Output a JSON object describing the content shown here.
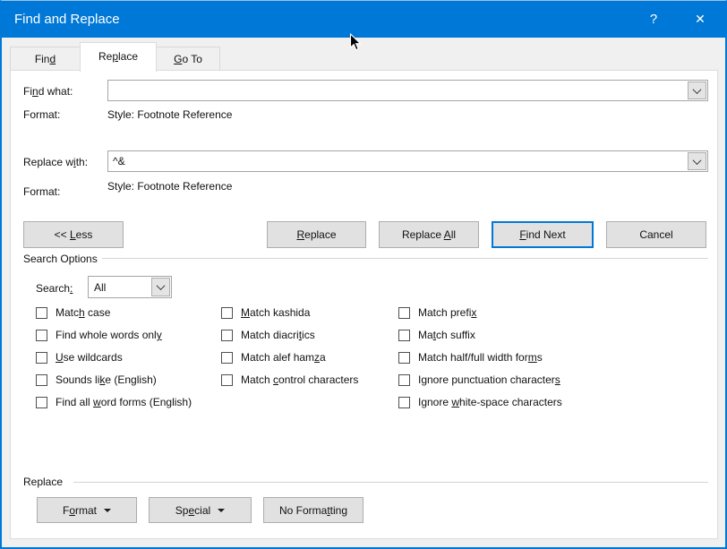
{
  "window": {
    "title": "Find and Replace",
    "help": "?",
    "close": "✕"
  },
  "colors": {
    "titlebar": "#0078d7",
    "accent": "#0078d7",
    "dialog_bg": "#f0f0f0",
    "page_bg": "#ffffff",
    "button_face": "#e1e1e1",
    "button_border": "#adadad"
  },
  "icons": {
    "help": "question-mark",
    "close": "x-cross",
    "combo_arrow": "chevron-down",
    "menu_arrow": "triangle-down"
  },
  "tabs": [
    {
      "pre": "Fin",
      "key": "d",
      "post": ""
    },
    {
      "pre": "Re",
      "key": "p",
      "post": "lace"
    },
    {
      "pre": "",
      "key": "G",
      "post": "o To"
    }
  ],
  "find_row": {
    "label": {
      "pre": "Fi",
      "key": "n",
      "post": "d what:"
    },
    "value": "",
    "format_label": "Format:",
    "format_value": "Style: Footnote Reference"
  },
  "replace_row": {
    "label": {
      "pre": "Replace w",
      "key": "i",
      "post": "th:"
    },
    "value": "^&",
    "format_label": "Format:",
    "format_value": "Style: Footnote Reference"
  },
  "action_buttons": {
    "less": {
      "pre": "<< ",
      "key": "L",
      "post": "ess"
    },
    "replace": {
      "pre": "",
      "key": "R",
      "post": "eplace"
    },
    "replace_all": {
      "pre": "Replace ",
      "key": "A",
      "post": "ll"
    },
    "find_next": {
      "pre": "",
      "key": "F",
      "post": "ind Next"
    },
    "cancel": {
      "pre": "Cancel",
      "key": "",
      "post": ""
    }
  },
  "search_options": {
    "group_label": "Search Options",
    "search_label": {
      "pre": "Search",
      "key": ":",
      "post": ""
    },
    "search_value": "All",
    "columns": [
      [
        {
          "pre": "Matc",
          "key": "h",
          "post": " case"
        },
        {
          "pre": "Find whole words onl",
          "key": "y",
          "post": ""
        },
        {
          "pre": "",
          "key": "U",
          "post": "se wildcards"
        },
        {
          "pre": "Sounds li",
          "key": "k",
          "post": "e (English)"
        },
        {
          "pre": "Find all ",
          "key": "w",
          "post": "ord forms (English)"
        }
      ],
      [
        {
          "pre": "",
          "key": "M",
          "post": "atch kashida"
        },
        {
          "pre": "Match diacri",
          "key": "t",
          "post": "ics"
        },
        {
          "pre": "Match alef ham",
          "key": "z",
          "post": "a"
        },
        {
          "pre": "Match ",
          "key": "c",
          "post": "ontrol characters"
        }
      ],
      [
        {
          "pre": "Match prefi",
          "key": "x",
          "post": ""
        },
        {
          "pre": "Ma",
          "key": "t",
          "post": "ch suffix"
        },
        {
          "pre": "Match half/full width for",
          "key": "m",
          "post": "s"
        },
        {
          "pre": "Ignore punctuation character",
          "key": "s",
          "post": ""
        },
        {
          "pre": "Ignore ",
          "key": "w",
          "post": "hite-space characters"
        }
      ]
    ]
  },
  "replace_section": {
    "group_label": "Replace",
    "format": {
      "pre": "F",
      "key": "o",
      "post": "rmat"
    },
    "special": {
      "pre": "Sp",
      "key": "e",
      "post": "cial"
    },
    "no_formatting": {
      "pre": "No Forma",
      "key": "t",
      "post": "ting"
    }
  }
}
